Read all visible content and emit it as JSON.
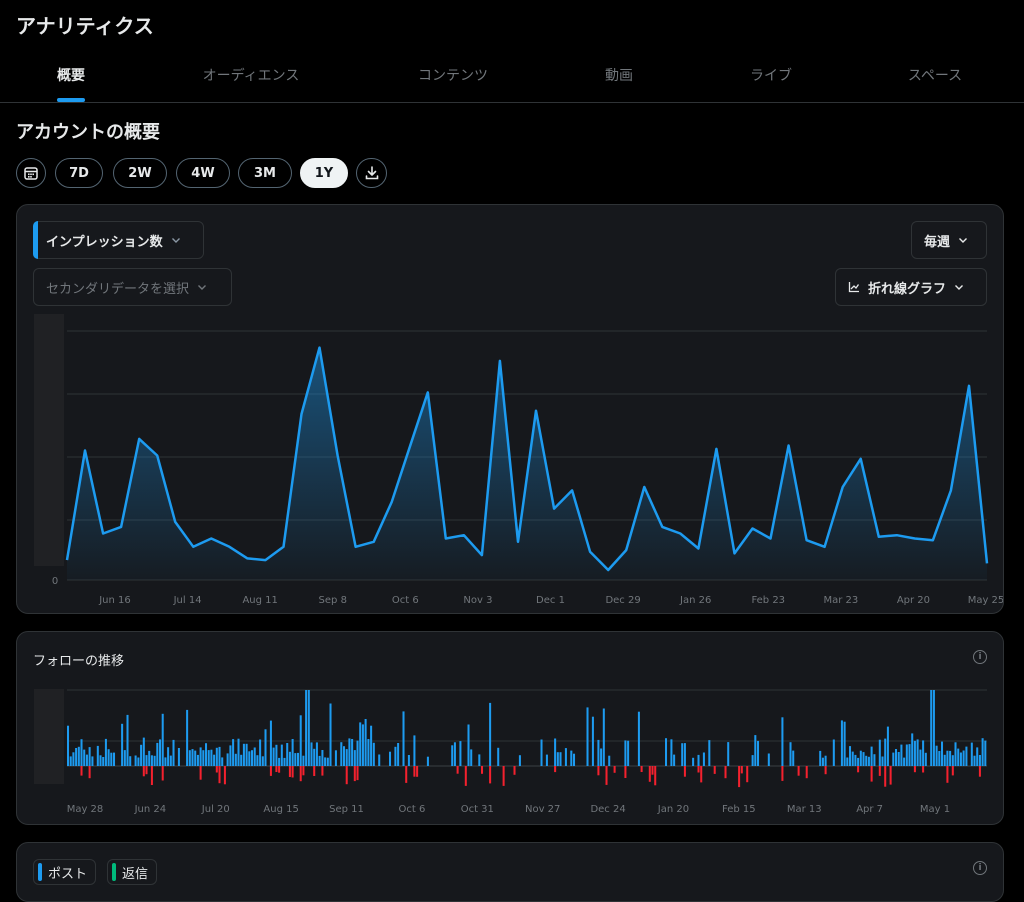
{
  "header": {
    "title": "アナリティクス"
  },
  "tabs": [
    {
      "label": "概要",
      "active": true
    },
    {
      "label": "オーディエンス"
    },
    {
      "label": "コンテンツ"
    },
    {
      "label": "動画"
    },
    {
      "label": "ライブ"
    },
    {
      "label": "スペース"
    }
  ],
  "overview": {
    "title": "アカウントの概要",
    "calendar_icon": "calendar-icon",
    "download_icon": "download-icon",
    "ranges": [
      "7D",
      "2W",
      "4W",
      "3M",
      "1Y"
    ],
    "selected_range": "1Y"
  },
  "main_chart": {
    "primary_metric": "インプレッション数",
    "secondary_placeholder": "セカンダリデータを選択",
    "interval": "毎週",
    "chart_type_label": "折れ線グラフ",
    "chart_type_icon": "line-chart-icon",
    "accent": "#1d9bf0"
  },
  "follow_chart": {
    "title": "フォローの推移",
    "info_icon": "info-icon",
    "positive_color": "#1d9bf0",
    "negative_color": "#f4212e"
  },
  "bottom_card": {
    "legend": [
      {
        "label": "ポスト",
        "color": "#1d9bf0"
      },
      {
        "label": "返信",
        "color": "#00ba7c"
      }
    ],
    "info_icon": "info-icon"
  },
  "chart_data": [
    {
      "type": "area",
      "title": "",
      "x_ticks": [
        "Jun 16",
        "Jul 14",
        "Aug 11",
        "Sep 8",
        "Oct 6",
        "Nov 3",
        "Dec 1",
        "Dec 29",
        "Jan 26",
        "Feb 23",
        "Mar 23",
        "Apr 20",
        "May 25"
      ],
      "y_ticks": [
        "0"
      ],
      "grid": true,
      "values": [
        12,
        78,
        28,
        32,
        85,
        75,
        35,
        20,
        25,
        20,
        13,
        12,
        20,
        100,
        140,
        75,
        20,
        23,
        47,
        80,
        113,
        25,
        27,
        15,
        132,
        23,
        102,
        43,
        54,
        17,
        6,
        18,
        56,
        32,
        28,
        19,
        79,
        16,
        31,
        25,
        81,
        24,
        20,
        56,
        73,
        26,
        27,
        25,
        24,
        54,
        117,
        10
      ]
    },
    {
      "type": "bar",
      "title": "フォローの推移",
      "x_ticks": [
        "May 28",
        "Jun 24",
        "Jul 20",
        "Aug 15",
        "Sep 11",
        "Oct 6",
        "Oct 31",
        "Nov 27",
        "Dec 24",
        "Jan 20",
        "Feb 15",
        "Mar 13",
        "Apr 7",
        "May 1"
      ],
      "note": "daily follows (positive) and unfollows (negative)"
    }
  ]
}
